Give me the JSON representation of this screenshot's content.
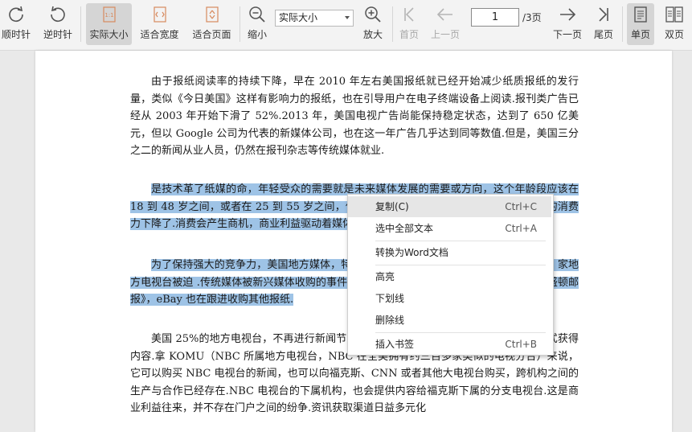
{
  "toolbar": {
    "rotate_cw": "顺时针",
    "rotate_ccw": "逆时针",
    "actual_size": "实际大小",
    "fit_width": "适合宽度",
    "fit_page": "适合页面",
    "zoom_out": "缩小",
    "zoom_value": "实际大小",
    "zoom_in": "放大",
    "first_page": "首页",
    "prev_page": "上一页",
    "current_page": "1",
    "total_pages": "/3页",
    "next_page": "下一页",
    "last_page": "尾页",
    "single_page": "单页",
    "double_page": "双页"
  },
  "document": {
    "p1": "由于报纸阅读率的持续下降，早在 2010 年左右美国报纸就已经开始减少纸质报纸的发行量，类似《今日美国》这样有影响力的报纸，也在引导用户在电子终端设备上阅读.报刊类广告已经从 2003 年开始下滑了 52%.2013 年，美国电视广告尚能保持稳定状态，达到了 650 亿美元，但以 Google 公司为代表的新媒体公司，也在这一年广告几乎达到同等数值.但是，美国三分之二的新闻从业人员，仍然在报刊杂志等传统媒体就业.",
    "p2": "是技术革了纸媒的命，年轻受众的需要就是未来媒体发展的需要或方向，这个年龄段应该在 18 到 48 岁之间，或者在 25 到 55 岁之间，传统媒体失去了年轻受众的关注，因为他们的消费力下降了.消费会产生商机，商业利益驱动着媒体的发展.",
    "p3": "为了保持强大的竞争力，美国地方媒体，特别是地方电视台纷纷进行合并，全美有 290 家地方电视台被迫 .传统媒体被新兴媒体收购的事件层出不穷，亚马逊创始人贝索斯收购了《华盛顿邮报》，eBay 也在跟进收购其他报纸.",
    "p4": "美国 25%的地方电视台，不再进行新闻节目的独立制作，而是采用共享新闻内容的方式获得内容.拿 KOMU（NBC 所属地方电视台，NBC 在全美拥有约三百多家类似的电视分台）来说，它可以购买 NBC 电视台的新闻，也可以向福克斯、CNN 或者其他大电视台购买，跨机构之间的生产与合作已经存在.NBC 电视台的下属机构，也会提供内容给福克斯下属的分支电视台.这是商业利益往来，并不存在门户之间的纷争.资讯获取渠道日益多元化"
  },
  "context_menu": {
    "copy": "复制(C)",
    "copy_shortcut": "Ctrl+C",
    "select_all": "选中全部文本",
    "select_all_shortcut": "Ctrl+A",
    "to_word": "转换为Word文档",
    "highlight": "高亮",
    "underline": "下划线",
    "strikethrough": "删除线",
    "bookmark": "插入书签",
    "bookmark_shortcut": "Ctrl+B"
  },
  "colors": {
    "selection": "#9ec3e6",
    "toolbar_bg": "#f3f3f3",
    "selected_button_bg": "#d5d5d5"
  }
}
